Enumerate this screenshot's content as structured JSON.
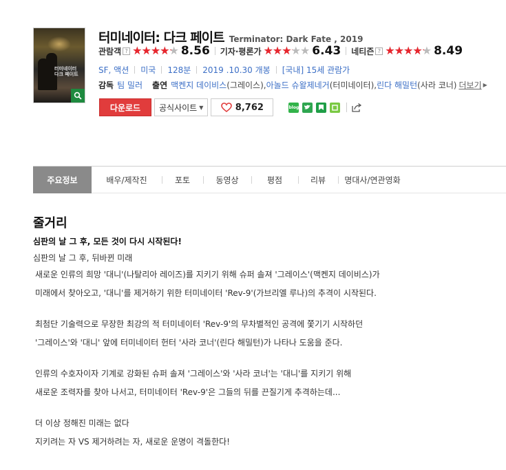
{
  "movie": {
    "poster_title": "터미네이터 다크 페이트",
    "title_ko": "터미네이터: 다크 페이트",
    "title_en": "Terminator: Dark Fate , 2019"
  },
  "ratings": [
    {
      "label": "관람객",
      "help": "?",
      "score": "8.56",
      "fill": 0.856
    },
    {
      "label": "기자·평론가",
      "help": "",
      "score": "6.43",
      "fill": 0.643
    },
    {
      "label": "네티즌",
      "help": "?",
      "score": "8.49",
      "fill": 0.849
    }
  ],
  "meta": {
    "genre": "SF, 액션",
    "country": "미국",
    "runtime": "128분",
    "release": "2019 .10.30 개봉",
    "grade": "[국내] 15세 관람가"
  },
  "credits": {
    "director_label": "감독",
    "director": "팀 밀러",
    "cast_label": "출연",
    "cast": [
      {
        "actor": "맥켄지 데이비스",
        "role": "(그레이스), "
      },
      {
        "actor": "아놀드 슈왈제네거",
        "role": "(터미네이터), "
      },
      {
        "actor": "린다 해밀턴",
        "role": "(사라 코너)"
      }
    ],
    "more": "더보기"
  },
  "actions": {
    "download": "다운로드",
    "official": "공식사이트",
    "likes": "8,762"
  },
  "share_icons": [
    "blog",
    "twitter",
    "book",
    "line",
    "copy"
  ],
  "tabs": [
    {
      "label": "주요정보",
      "width": 85,
      "active": true
    },
    {
      "label": "배우/제작진",
      "width": 102
    },
    {
      "label": "포토",
      "width": 60
    },
    {
      "label": "동영상",
      "width": 70
    },
    {
      "label": "평점",
      "width": 68
    },
    {
      "label": "리뷰",
      "width": 58
    },
    {
      "label": "명대사/연관영화",
      "width": 100
    }
  ],
  "synopsis": {
    "title": "줄거리",
    "headline": "심판의 날 그 후, 모든 것이 다시 시작된다!",
    "paragraphs": [
      [
        "심판의 날 그 후, 뒤바뀐 미래",
        "새로운 인류의 희망 '대니'(나탈리아 레이즈)를 지키기 위해 슈퍼 솔져 '그레이스'(맥켄지 데이비스)가",
        "미래에서 찾아오고, '대니'를 제거하기 위한 터미네이터 'Rev-9'(가브리엘 루나)의 추격이 시작된다."
      ],
      [
        "최첨단 기술력으로 무장한 최강의 적 터미네이터 'Rev-9'의 무차별적인 공격에 쫓기기 시작하던",
        "'그레이스'와 '대니' 앞에 터미네이터 헌터 '사라 코너'(린다 해밀턴)가 나타나 도움을 준다."
      ],
      [
        "인류의 수호자이자 기계로 강화된 슈퍼 솔져 '그레이스'와 '사라 코너'는 '대니'를 지키기 위해",
        "새로운 조력자를 찾아 나서고, 터미네이터 'Rev-9'은 그들의 뒤를 끈질기게 추격하는데..."
      ],
      [
        "더 이상 정해진 미래는 없다",
        "지키려는 자 VS 제거하려는 자, 새로운 운명이 격돌한다!"
      ]
    ]
  }
}
